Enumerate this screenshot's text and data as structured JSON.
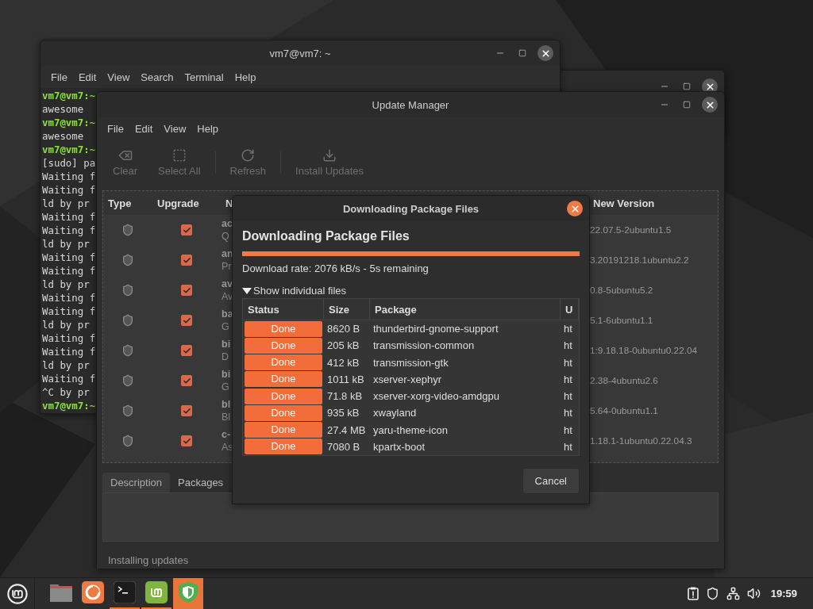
{
  "terminal": {
    "title": "vm7@vm7: ~",
    "menu": [
      "File",
      "Edit",
      "View",
      "Search",
      "Terminal",
      "Help"
    ],
    "lines": [
      {
        "kind": "prompt",
        "text": "vm7@vm7:~"
      },
      {
        "kind": "output",
        "text": "awesome"
      },
      {
        "kind": "prompt",
        "text": "vm7@vm7:~"
      },
      {
        "kind": "output",
        "text": "awesome"
      },
      {
        "kind": "prompt",
        "text": "vm7@vm7:~"
      },
      {
        "kind": "output",
        "text": "[sudo] pa"
      },
      {
        "kind": "output",
        "text": "Waiting f"
      },
      {
        "kind": "output",
        "text": "Waiting f"
      },
      {
        "kind": "output",
        "text": "ld by pr"
      },
      {
        "kind": "output",
        "text": "Waiting f"
      },
      {
        "kind": "output",
        "text": "Waiting f"
      },
      {
        "kind": "output",
        "text": "ld by pr"
      },
      {
        "kind": "output",
        "text": "Waiting f"
      },
      {
        "kind": "output",
        "text": "Waiting f"
      },
      {
        "kind": "output",
        "text": "ld by pr"
      },
      {
        "kind": "output",
        "text": "Waiting f"
      },
      {
        "kind": "output",
        "text": "Waiting f"
      },
      {
        "kind": "output",
        "text": "ld by pr"
      },
      {
        "kind": "output",
        "text": "Waiting f"
      },
      {
        "kind": "output",
        "text": "Waiting f"
      },
      {
        "kind": "output",
        "text": "ld by pr"
      },
      {
        "kind": "output",
        "text": "Waiting f"
      },
      {
        "kind": "output",
        "text": "^C by pr"
      },
      {
        "kind": "prompt",
        "text": "vm7@vm7:~"
      }
    ]
  },
  "update_manager": {
    "title": "Update Manager",
    "menu": [
      "File",
      "Edit",
      "View",
      "Help"
    ],
    "toolbar": [
      {
        "kind": "clear",
        "label": "Clear",
        "disabled": true
      },
      {
        "kind": "select",
        "label": "Select All",
        "disabled": true
      },
      {
        "kind": "refresh",
        "label": "Refresh",
        "disabled": true
      },
      {
        "kind": "install",
        "label": "Install Updates",
        "disabled": true
      }
    ],
    "columns": [
      "Type",
      "Upgrade",
      "N",
      "New Version"
    ],
    "rows": [
      {
        "checked": true,
        "name": "ac",
        "description": "Q",
        "new_version": "22.07.5-2ubuntu1.5"
      },
      {
        "checked": true,
        "name": "an",
        "description": "Pr",
        "new_version": "3.20191218.1ubuntu2.2"
      },
      {
        "checked": true,
        "name": "av",
        "description": "Av",
        "new_version": "0.8-5ubuntu5.2"
      },
      {
        "checked": true,
        "name": "ba",
        "description": "G",
        "new_version": "5.1-6ubuntu1.1"
      },
      {
        "checked": true,
        "name": "bi",
        "description": "D",
        "new_version": "1:9.18.18-0ubuntu0.22.04"
      },
      {
        "checked": true,
        "name": "bi",
        "description": "G",
        "new_version": "2.38-4ubuntu2.6"
      },
      {
        "checked": true,
        "name": "bl",
        "description": "Bl",
        "new_version": "5.64-0ubuntu1.1"
      },
      {
        "checked": true,
        "name": "c-",
        "description": "As",
        "new_version": "1.18.1-1ubuntu0.22.04.3"
      }
    ],
    "tabs": [
      {
        "label": "Description",
        "selected": true
      },
      {
        "label": "Packages",
        "selected": false
      }
    ],
    "status": "Installing updates"
  },
  "dialog": {
    "title": "Downloading Package Files",
    "heading": "Downloading Package Files",
    "progress": {
      "level": 1
    },
    "rate": "Download rate: 2076 kB/s - 5s remaining",
    "expander": {
      "label": "Show individual files",
      "expanded": true
    },
    "columns": [
      "Status",
      "Size",
      "Package",
      "U"
    ],
    "files": [
      {
        "status": "Done",
        "size": "8620  B",
        "package": "thunderbird-gnome-support",
        "url": "ht"
      },
      {
        "status": "Done",
        "size": "205 kB",
        "package": "transmission-common",
        "url": "ht"
      },
      {
        "status": "Done",
        "size": "412 kB",
        "package": "transmission-gtk",
        "url": "ht"
      },
      {
        "status": "Done",
        "size": "1011 kB",
        "package": "xserver-xephyr",
        "url": "ht"
      },
      {
        "status": "Done",
        "size": "71.8 kB",
        "package": "xserver-xorg-video-amdgpu",
        "url": "ht"
      },
      {
        "status": "Done",
        "size": "935 kB",
        "package": "xwayland",
        "url": "ht"
      },
      {
        "status": "Done",
        "size": "27.4 MB",
        "package": "yaru-theme-icon",
        "url": "ht"
      },
      {
        "status": "Done",
        "size": "7080  B",
        "package": "kpartx-boot",
        "url": "ht"
      }
    ],
    "cancel": "Cancel"
  },
  "taskbar": {
    "apps": [
      {
        "kind": "files",
        "running": false,
        "active": false
      },
      {
        "kind": "browser",
        "running": false,
        "active": false
      },
      {
        "kind": "terminal",
        "running": true,
        "active": false
      },
      {
        "kind": "updater",
        "running": true,
        "active": false
      },
      {
        "kind": "shield",
        "running": true,
        "active": true
      }
    ],
    "clock": "19:59"
  }
}
